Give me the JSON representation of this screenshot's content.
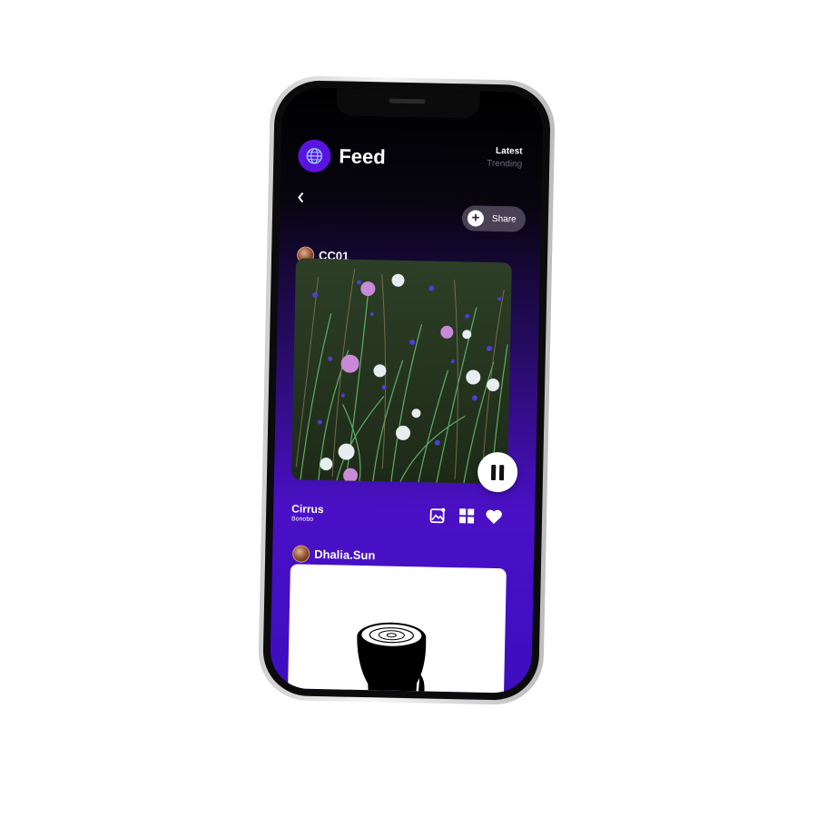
{
  "header": {
    "title": "Feed",
    "tabs": [
      {
        "label": "Latest",
        "active": true
      },
      {
        "label": "Trending",
        "active": false
      }
    ]
  },
  "share_button": {
    "label": "Share"
  },
  "posts": [
    {
      "username": "CC01",
      "track": {
        "title": "Cirrus",
        "artist": "Bonobo"
      },
      "artwork": "wildflowers-thistles-image",
      "playback": "playing"
    },
    {
      "username": "Dhalia.Sun",
      "artwork": "black-tree-stump-illustration"
    }
  ],
  "icons": {
    "globe": "globe-icon",
    "back": "chevron-left-icon",
    "share": "plus-icon",
    "pause": "pause-icon",
    "image": "image-icon",
    "grid": "grid-icon",
    "heart": "heart-icon"
  },
  "colors": {
    "accent": "#5a14e0",
    "gradient_bottom": "#4a10c6",
    "background_top": "#000000"
  }
}
